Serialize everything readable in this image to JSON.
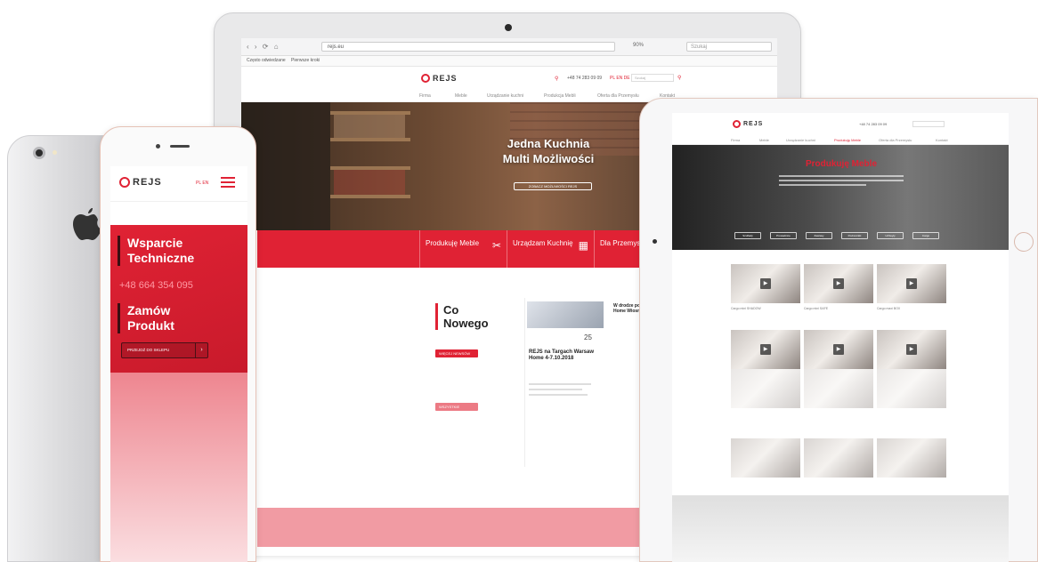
{
  "laptop": {
    "browser": {
      "nav_glyphs": "‹ › ⟳ ⌂",
      "url": "rejs.eu",
      "zoom": "90%",
      "search_placeholder": "Szukaj"
    },
    "bookmarks": [
      "Często odwiedzane",
      "Pierwsze kroki"
    ],
    "site": {
      "brand": "REJS",
      "phone": "+48 74 283 09 09",
      "lang": "PL  EN  DE",
      "search_placeholder": "Szukaj",
      "nav": [
        "Firma",
        "Meble",
        "Urządzanie kuchni",
        "Produkcja Mebli",
        "Oferta dla Przemysłu",
        "Kontakt"
      ],
      "hero_title_line1": "Jedna Kuchnia",
      "hero_title_line2": "Multi Możliwości",
      "hero_button": "ZOBACZ MOŻLIWOŚCI REJS",
      "band": [
        {
          "label": "Produkuję Meble",
          "icon": "✂"
        },
        {
          "label": "Urządzam Kuchnię",
          "icon": "▦"
        },
        {
          "label": "Dla Przemysłu",
          "icon": "⚙"
        }
      ],
      "news_title_line1": "Co",
      "news_title_line2": "Nowego",
      "news_button": "WIĘCEJ NEWSÓW",
      "news_button2": "WSZYSTKIE",
      "news_card": {
        "date": "25",
        "title": "REJS na Targach Warsaw Home 4-7.10.2018"
      },
      "news_col2": "W drodze po Warsaw Home Wiosna 2018"
    }
  },
  "tablet": {
    "brand": "REJS",
    "phone": "+48 74 283 09 09",
    "nav": [
      "Firma",
      "Meble",
      "Urządzanie kuchni",
      "Produkuję Meble",
      "Oferta dla Przemysłu",
      "Kontakt"
    ],
    "hero_title": "Produkuję Meble",
    "tabs": [
      "Szuflady",
      "Prowadnice",
      "Zawiasy",
      "Podnośniki",
      "Uchwyty",
      "Cargo"
    ],
    "tiles": [
      {
        "caption": "Cargo mini SHADOW"
      },
      {
        "caption": "Cargo mini SAFE"
      },
      {
        "caption": "Cargo maxi BOX"
      },
      {
        "caption": ""
      },
      {
        "caption": ""
      },
      {
        "caption": ""
      }
    ]
  },
  "phone": {
    "brand": "REJS",
    "lang": "PL  EN",
    "heading1_line1": "Wsparcie",
    "heading1_line2": "Techniczne",
    "phone_number": "+48 664 354 095",
    "heading2_line1": "Zamów",
    "heading2_line2": "Produkt",
    "shop_button": "PRZEJDŹ DO SKLEPU",
    "shop_arrow": "›"
  },
  "phone_back": {
    "logo_glyph": "●"
  },
  "colors": {
    "brand_red": "#e02234",
    "dark": "#222222"
  }
}
